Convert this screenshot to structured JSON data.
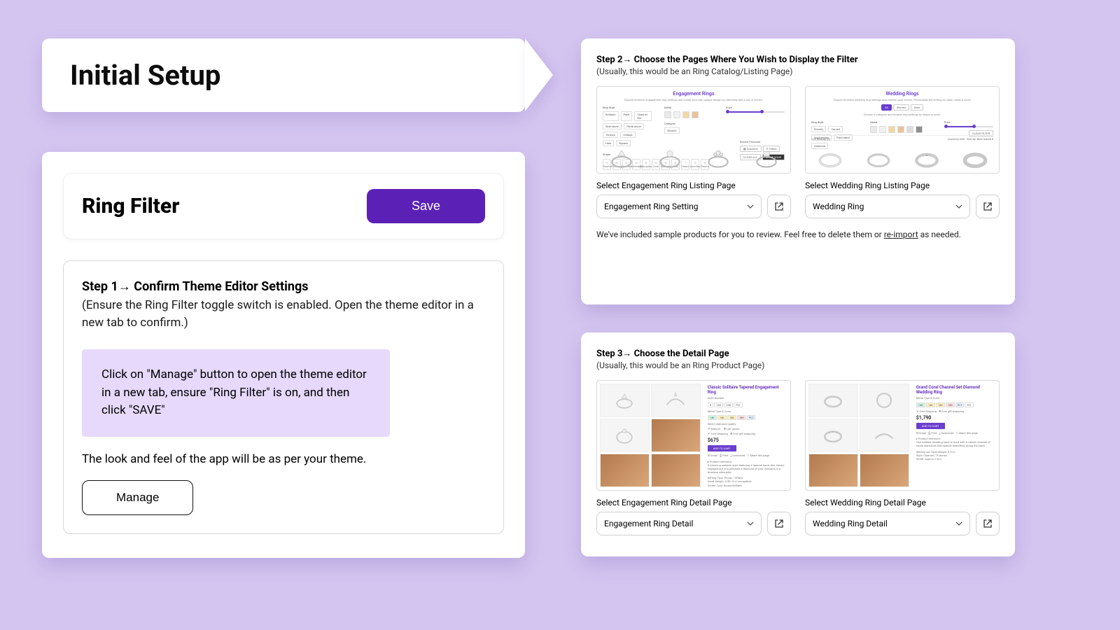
{
  "banner": {
    "title": "Initial Setup"
  },
  "ring_filter": {
    "title": "Ring Filter",
    "save_label": "Save",
    "step1_title": "Step 1→  Confirm Theme Editor Settings",
    "step1_sub": "(Ensure the Ring Filter toggle switch is enabled. Open the theme editor in a new tab to confirm.)",
    "callout": "Click on \"Manage\" button to open the theme editor in a new tab, ensure \"Ring Filter\" is on, and then click \"SAVE\"",
    "theme_note": "The look and feel of the app will be as per your theme.",
    "manage_label": "Manage"
  },
  "step2": {
    "title": "Step 2→ Choose the Pages Where You Wish to Display the Filter",
    "sub": "(Usually, this would be an Ring Catalog/Listing Page)",
    "left": {
      "preview_title": "Engagement Rings",
      "label": "Select Engagement Ring Listing Page",
      "value": "Engagement Ring Setting"
    },
    "right": {
      "preview_title": "Wedding Rings",
      "label": "Select Wedding Ring Listing Page",
      "value": "Wedding Ring"
    },
    "sample_note_pre": "We've included sample products for you to review. Feel free to delete them or ",
    "sample_note_link": "re-import",
    "sample_note_post": " as needed."
  },
  "step3": {
    "title": "Step 3→ Choose the Detail Page",
    "sub": "(Usually, this would be an Ring Product Page)",
    "left": {
      "preview_title": "Classic Solitaire Tapered Engagement Ring",
      "price": "$675",
      "label": "Select Engagement Ring Detail Page",
      "value": "Engagement Ring Detail"
    },
    "right": {
      "preview_title": "Grand Coral Channel Set Diamond Wedding Ring",
      "price": "$1,790",
      "label": "Select Wedding Ring Detail Page",
      "value": "Wedding Ring Detail"
    }
  }
}
